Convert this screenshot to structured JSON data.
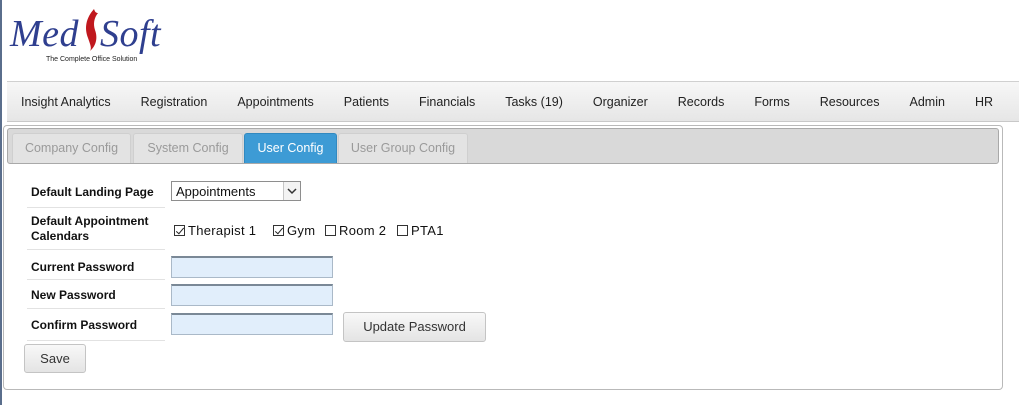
{
  "logo": {
    "name_left": "Med",
    "name_right": "Soft",
    "tagline": "The Complete Office Solution"
  },
  "nav": {
    "items": [
      "Insight Analytics",
      "Registration",
      "Appointments",
      "Patients",
      "Financials",
      "Tasks (19)",
      "Organizer",
      "Records",
      "Forms",
      "Resources",
      "Admin",
      "HR"
    ]
  },
  "tabs": {
    "company": "Company Config",
    "system": "System Config",
    "user": "User Config",
    "user_group": "User Group Config",
    "active": "User Config"
  },
  "form": {
    "landing_label": "Default Landing Page",
    "landing_value": "Appointments",
    "calendars_label": "Default Appointment Calendars",
    "calendars": [
      {
        "label": "Therapist 1",
        "checked": true
      },
      {
        "label": "Gym",
        "checked": true
      },
      {
        "label": "Room 2",
        "checked": false
      },
      {
        "label": "PTA1",
        "checked": false
      }
    ],
    "current_password_label": "Current Password",
    "new_password_label": "New Password",
    "confirm_password_label": "Confirm Password",
    "update_password_button": "Update Password",
    "save_button": "Save"
  },
  "colors": {
    "active_tab": "#3d9bd5",
    "logo_blue": "#2f3f8f",
    "logo_flame": "#c0181e",
    "input_bg": "#e1eefb"
  }
}
